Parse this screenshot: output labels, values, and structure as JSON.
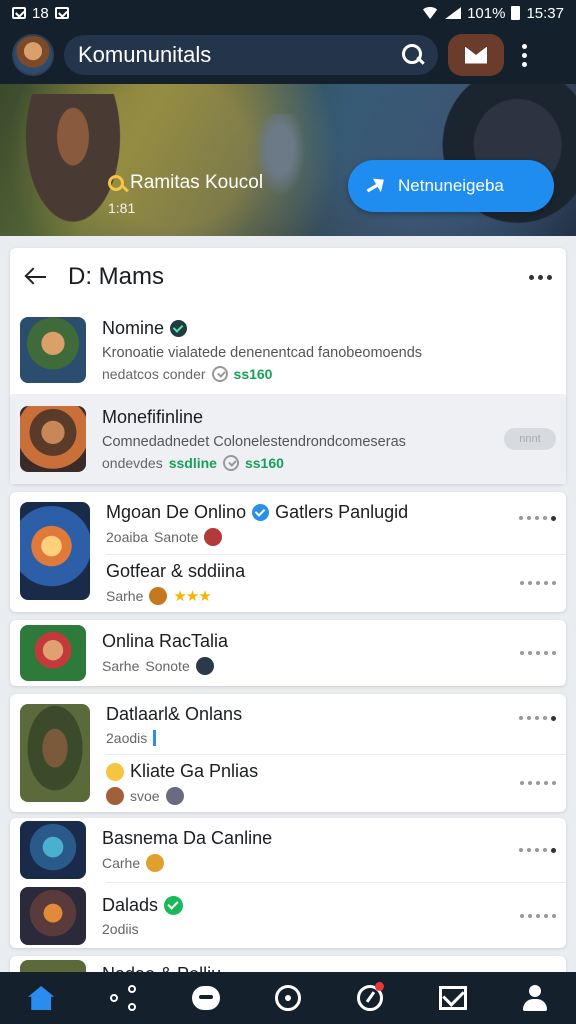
{
  "status": {
    "time_left": "18",
    "battery": "101%",
    "clock": "15:37"
  },
  "header": {
    "title": "Komununitals"
  },
  "banner": {
    "label": "Ramitas Koucol",
    "sublabel": "1:81",
    "button": "Netnuneigeba"
  },
  "panel": {
    "title": "D: Mams",
    "items": [
      {
        "title": "Nomine",
        "desc": "Kronoatie vialatede denenentcad fanobeomoends",
        "meta_text": "nedatcos conder",
        "meta_value": "ss160"
      },
      {
        "title": "Monefifinline",
        "desc": "Comnedadnedet Colonelestendrondcomeseras",
        "meta_text": "ondevdes",
        "meta_value_a": "ssdline",
        "meta_value_b": "ss160",
        "pill": "nnnt"
      }
    ]
  },
  "cards": [
    {
      "rows": [
        {
          "title": "Mgoan De Onlino",
          "title_b": "Gatlers Panlugid",
          "meta_a": "2oaiba",
          "meta_b": "Sanote"
        },
        {
          "title": "Gotfear & sddiina",
          "meta_a": "Sarhe",
          "stars": "★★★"
        }
      ]
    },
    {
      "rows": [
        {
          "title": "Onlina RacTalia",
          "meta_a": "Sarhe",
          "meta_b": "Sonote"
        }
      ]
    },
    {
      "rows": [
        {
          "title": "Datlaarl& Onlans",
          "meta_a": "2aodis"
        },
        {
          "title": "Kliate Ga Pnlias",
          "meta_a": "svoe"
        }
      ]
    },
    {
      "rows": [
        {
          "title": "Basnema Da Canline",
          "meta_a": "Carhe"
        },
        {
          "title": "Dalads",
          "meta_a": "2odiis"
        }
      ]
    },
    {
      "rows": [
        {
          "title": "Nadae & Pelliu"
        }
      ]
    }
  ],
  "colors": {
    "bar": "#15202d",
    "accent": "#1f8df0",
    "green": "#17a05a"
  }
}
